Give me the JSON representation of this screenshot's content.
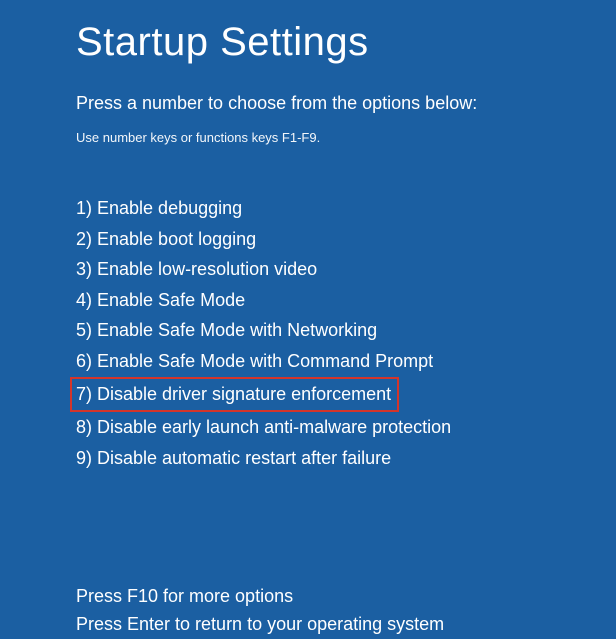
{
  "title": "Startup Settings",
  "subtitle": "Press a number to choose from the options below:",
  "hint": "Use number keys or functions keys F1-F9.",
  "options": [
    {
      "num": "1",
      "label": "Enable debugging",
      "highlighted": false
    },
    {
      "num": "2",
      "label": "Enable boot logging",
      "highlighted": false
    },
    {
      "num": "3",
      "label": "Enable low-resolution video",
      "highlighted": false
    },
    {
      "num": "4",
      "label": "Enable Safe Mode",
      "highlighted": false
    },
    {
      "num": "5",
      "label": "Enable Safe Mode with Networking",
      "highlighted": false
    },
    {
      "num": "6",
      "label": "Enable Safe Mode with Command Prompt",
      "highlighted": false
    },
    {
      "num": "7",
      "label": "Disable driver signature enforcement",
      "highlighted": true
    },
    {
      "num": "8",
      "label": "Disable early launch anti-malware protection",
      "highlighted": false
    },
    {
      "num": "9",
      "label": "Disable automatic restart after failure",
      "highlighted": false
    }
  ],
  "footer": {
    "more": "Press F10 for more options",
    "return": "Press Enter to return to your operating system"
  },
  "colors": {
    "background": "#1b5fa2",
    "text": "#ffffff",
    "highlight_border": "#d4352a"
  }
}
